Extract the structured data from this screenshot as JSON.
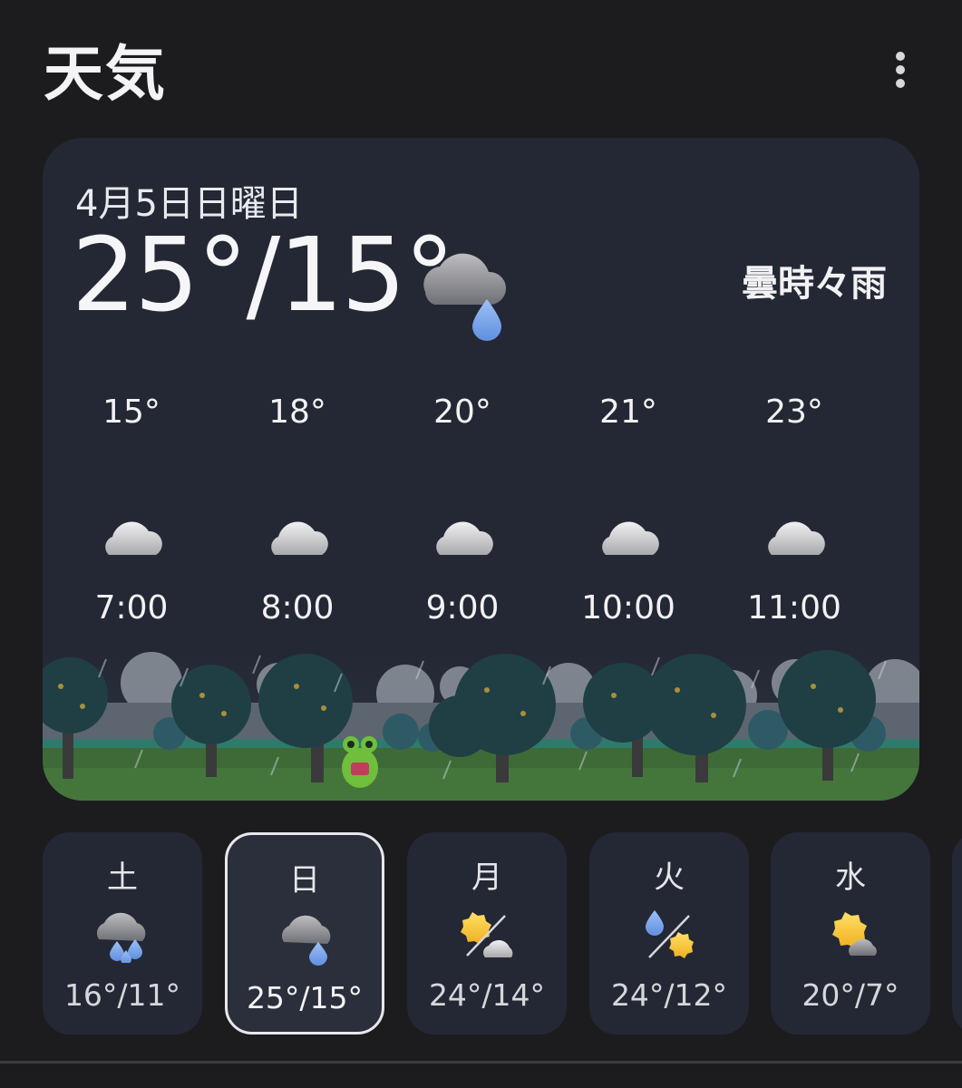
{
  "header": {
    "title": "天気",
    "menu_icon": "more-vert-icon"
  },
  "today": {
    "date": "4月5日日曜日",
    "high_low": "25°/15°",
    "condition": "曇時々雨",
    "icon": "cloud-rain-icon"
  },
  "hourly": [
    {
      "temp": "15°",
      "time": "7:00",
      "icon": "cloud-icon"
    },
    {
      "temp": "18°",
      "time": "8:00",
      "icon": "cloud-icon"
    },
    {
      "temp": "20°",
      "time": "9:00",
      "icon": "cloud-icon"
    },
    {
      "temp": "21°",
      "time": "10:00",
      "icon": "cloud-icon"
    },
    {
      "temp": "23°",
      "time": "11:00",
      "icon": "cloud-icon"
    }
  ],
  "daily": [
    {
      "day": "土",
      "range": "16°/11°",
      "icon": "cloud-heavy-rain-icon",
      "selected": false
    },
    {
      "day": "日",
      "range": "25°/15°",
      "icon": "cloud-rain-icon",
      "selected": true
    },
    {
      "day": "月",
      "range": "24°/14°",
      "icon": "sun-then-cloud-icon",
      "selected": false
    },
    {
      "day": "火",
      "range": "24°/12°",
      "icon": "rain-then-sun-icon",
      "selected": false
    },
    {
      "day": "水",
      "range": "20°/7°",
      "icon": "sun-cloud-icon",
      "selected": false
    }
  ],
  "colors": {
    "background": "#1c1c1f",
    "card": "#242834",
    "rain_drop": "#7fa9ee",
    "sun": "#f5c330",
    "cloud": "#c8c8cc"
  }
}
